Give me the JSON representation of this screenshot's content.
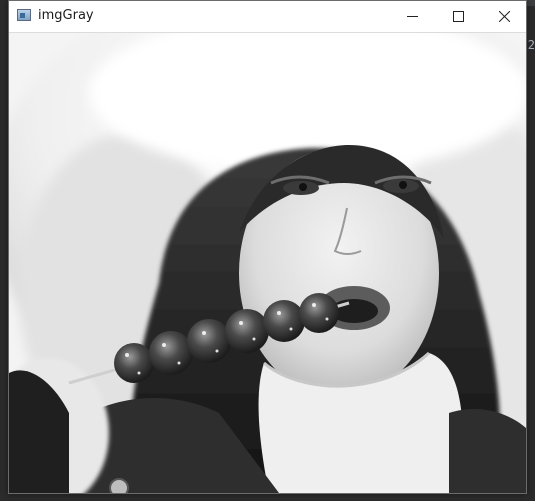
{
  "window": {
    "title": "imgGray"
  },
  "backdrop": {
    "partial_text": "2"
  },
  "icons": {
    "app": "app-window-icon",
    "minimize": "minimize-icon",
    "maximize": "maximize-icon",
    "close": "close-icon"
  },
  "image": {
    "description_key": "grayscale-photo",
    "alt": "imgGray"
  },
  "colors": {
    "titlebar_bg": "#ffffff",
    "title_text": "#1b1b1b",
    "editor_bg": "#2b2b2b",
    "close_hover": "#e81123"
  }
}
